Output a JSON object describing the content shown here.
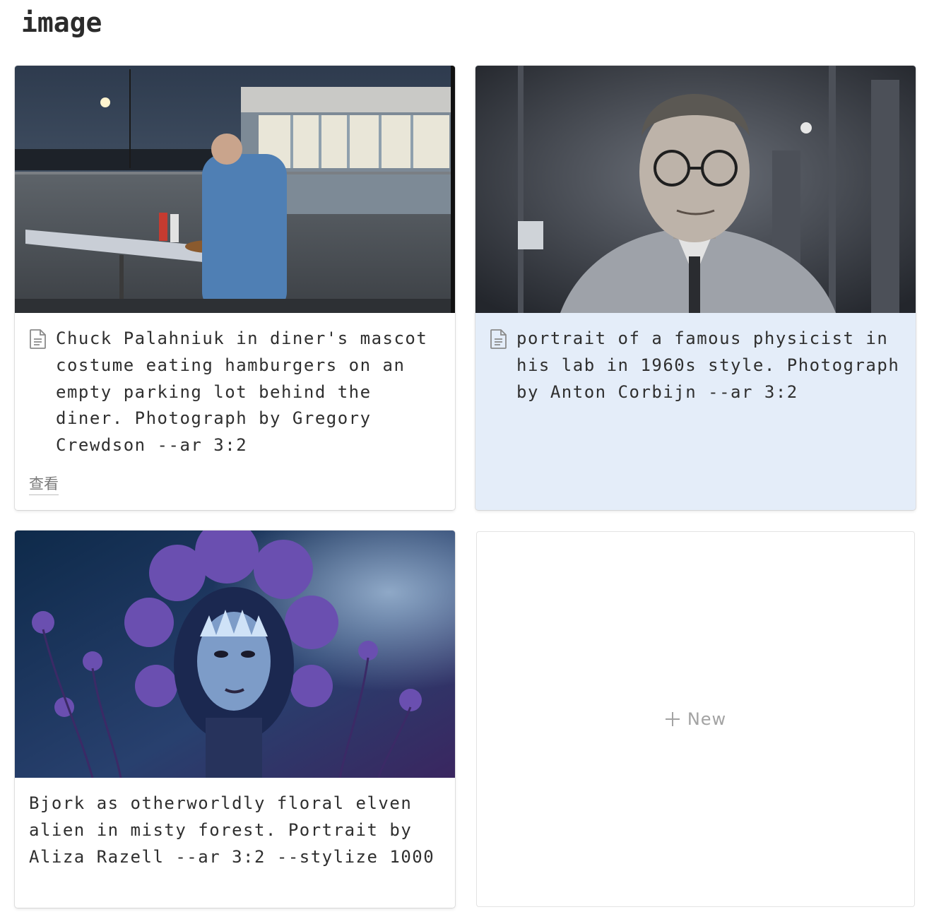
{
  "page": {
    "title": "image"
  },
  "cards": [
    {
      "title": "Chuck Palahniuk in diner's mascot costume eating hamburgers on an empty parking lot behind the diner. Photograph by Gregory Crewdson --ar 3:2",
      "view_label": "查看",
      "cover": "diner-photo"
    },
    {
      "title": "portrait of a famous physicist in his lab in 1960s style. Photograph by Anton Corbijn --ar 3:2",
      "cover": "physicist-photo",
      "selected": true
    },
    {
      "title": "Bjork as otherworldly floral elven alien in misty forest. Portrait by Aliza Razell --ar 3:2 --stylize 1000",
      "cover": "floral-portrait"
    }
  ],
  "new_button": {
    "label": "New",
    "icon": "plus-icon"
  },
  "colors": {
    "selected_bg": "#e4edf9",
    "text": "#2f2f2f",
    "muted": "#a3a3a3"
  }
}
